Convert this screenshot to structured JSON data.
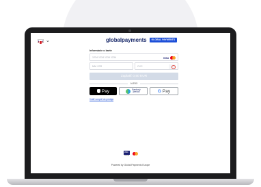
{
  "header": {
    "brand_name": "globalpayments",
    "brand_badge": "GLOBAL PAYMENTS"
  },
  "form": {
    "section_title": "Informácie o karte",
    "card_number_placeholder": "1234 1234 1234 1234",
    "expiry_placeholder": "MM / RR",
    "cvc_placeholder": "CVC",
    "visa_label": "VISA",
    "pay_button_label": "Zaplatiť 0,50 EUR",
    "divider_label": "ALEBO"
  },
  "wallets": {
    "apple_pay_label": "Pay",
    "bank_label_line1": "Bankový",
    "bank_label_line2": "prevod",
    "google_pay_label_g": "G",
    "google_pay_label": "Pay"
  },
  "links": {
    "back_link": "Vrátiť sa späť do predaja"
  },
  "footer": {
    "visa_label": "VISA",
    "visa_caption": "Verified",
    "powered_by": "Powered by Global Payments Europe"
  },
  "colors": {
    "brand": "#1b2b6b",
    "accent": "#1d4fd8",
    "pay_button_disabled": "#d3dbe7"
  }
}
